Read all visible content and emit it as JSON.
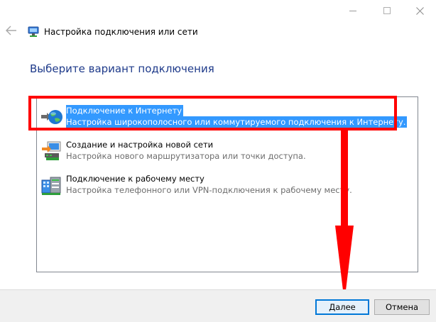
{
  "window": {
    "title": "Настройка подключения или сети"
  },
  "main": {
    "heading": "Выберите вариант подключения",
    "options": [
      {
        "title": "Подключение к Интернету",
        "description": "Настройка широкополосного или коммутируемого подключения к Интернету.",
        "icon": "globe-network-icon",
        "selected": true
      },
      {
        "title": "Создание и настройка новой сети",
        "description": "Настройка нового маршрутизатора или точки доступа.",
        "icon": "router-setup-icon",
        "selected": false
      },
      {
        "title": "Подключение к рабочему месту",
        "description": "Настройка телефонного или VPN-подключения к рабочему месту.",
        "icon": "workplace-vpn-icon",
        "selected": false
      }
    ]
  },
  "footer": {
    "next_label": "Далее",
    "cancel_label": "Отмена"
  },
  "colors": {
    "selection": "#3399ff",
    "annotation": "#ff0000",
    "heading": "#1e3a8a"
  }
}
